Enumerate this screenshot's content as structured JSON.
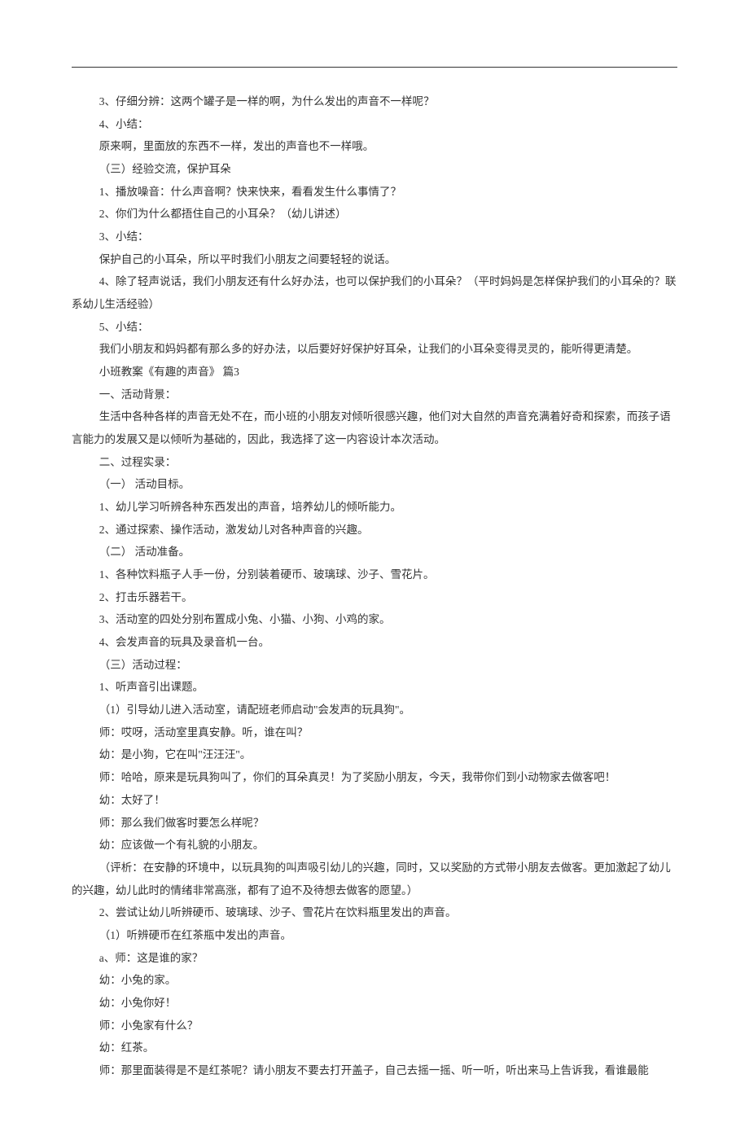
{
  "lines": [
    "3、仔细分辨：这两个罐子是一样的啊，为什么发出的声音不一样呢？",
    "4、小结：",
    "原来啊，里面放的东西不一样，发出的声音也不一样哦。",
    "（三）经验交流，保护耳朵",
    "1、播放噪音：什么声音啊？快来快来，看看发生什么事情了？",
    "2、你们为什么都捂住自己的小耳朵？（幼儿讲述）",
    "3、小结：",
    "保护自己的小耳朵，所以平时我们小朋友之间要轻轻的说话。",
    "4、除了轻声说话，我们小朋友还有什么好办法，也可以保护我们的小耳朵？（平时妈妈是怎样保护我们的小耳朵的？联系幼儿生活经验）",
    "5、小结：",
    "我们小朋友和妈妈都有那么多的好办法，以后要好好保护好耳朵，让我们的小耳朵变得灵灵的，能听得更清楚。",
    "小班教案《有趣的声音》 篇3",
    "一、活动背景：",
    "生活中各种各样的声音无处不在，而小班的小朋友对倾听很感兴趣，他们对大自然的声音充满着好奇和探索，而孩子语言能力的发展又是以倾听为基础的，因此，我选择了这一内容设计本次活动。",
    "二、过程实录：",
    "（一） 活动目标。",
    "1、幼儿学习听辨各种东西发出的声音，培养幼儿的倾听能力。",
    "2、通过探索、操作活动，激发幼儿对各种声音的兴趣。",
    "（二） 活动准备。",
    "1、各种饮料瓶子人手一份，分别装着硬币、玻璃球、沙子、雪花片。",
    "2、打击乐器若干。",
    "3、活动室的四处分别布置成小兔、小猫、小狗、小鸡的家。",
    "4、会发声音的玩具及录音机一台。",
    "（三）活动过程：",
    "1、听声音引出课题。",
    "（1）引导幼儿进入活动室，请配班老师启动\"会发声的玩具狗\"。",
    "师：哎呀，活动室里真安静。听，谁在叫？",
    "幼：是小狗，它在叫\"汪汪汪\"。",
    "师：哈哈，原来是玩具狗叫了，你们的耳朵真灵！为了奖励小朋友，今天，我带你们到小动物家去做客吧！",
    "幼：太好了！",
    "师：那么我们做客时要怎么样呢？",
    "幼：应该做一个有礼貌的小朋友。",
    "（评析：在安静的环境中，以玩具狗的叫声吸引幼儿的兴趣，同时，又以奖励的方式带小朋友去做客。更加激起了幼儿的兴趣，幼儿此时的情绪非常高涨，都有了迫不及待想去做客的愿望。）",
    "2、尝试让幼儿听辨硬币、玻璃球、沙子、雪花片在饮料瓶里发出的声音。",
    "（1）听辨硬币在红茶瓶中发出的声音。",
    "a、师：这是谁的家？",
    "幼：小兔的家。",
    "幼：小兔你好！",
    "师：小兔家有什么？",
    "幼：红茶。",
    "师：那里面装得是不是红茶呢？请小朋友不要去打开盖子，自己去摇一摇、听一听，听出来马上告诉我，看谁最能"
  ],
  "wrapLines": [
    8,
    13,
    32
  ]
}
